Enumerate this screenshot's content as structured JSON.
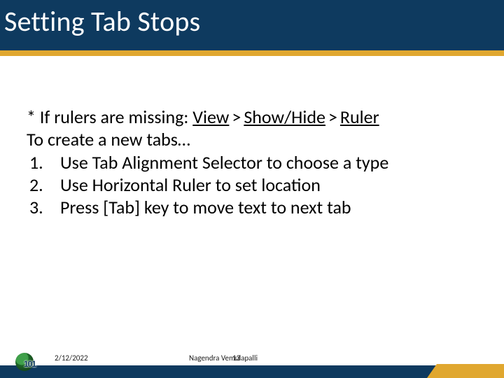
{
  "title": "Setting Tab Stops",
  "body": {
    "note_prefix": "* If rulers are missing: ",
    "menu_path": {
      "a": "View",
      "b": "Show/Hide",
      "c": "Ruler",
      "sep": ">"
    },
    "intro": "To create a new tabs…",
    "steps": [
      "Use Tab Alignment Selector to choose a type",
      "Use Horizontal Ruler to set location",
      "Press [Tab] key to move text to next tab"
    ]
  },
  "footer": {
    "date": "2/12/2022",
    "author": "Nagendra Vemulapalli",
    "page": "13"
  },
  "colors": {
    "bar": "#0e3a5f",
    "accent": "#e0a72f"
  }
}
